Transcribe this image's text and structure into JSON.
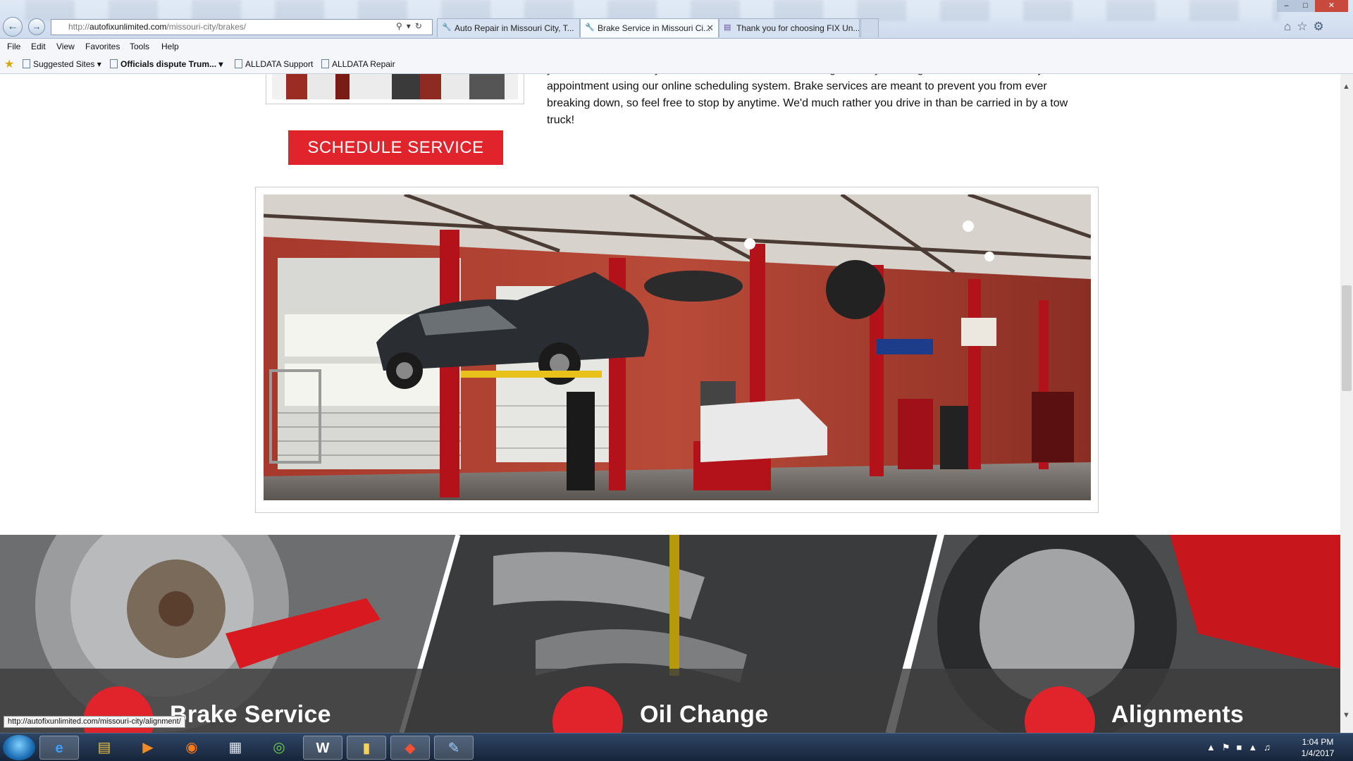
{
  "browser": {
    "url_domain": "autofixunlimited.com",
    "url_prefix": "http://",
    "url_path": "/missouri-city/brakes/",
    "tabs": [
      {
        "label": "Auto Repair in Missouri City, T...",
        "active": false
      },
      {
        "label": "Brake Service in Missouri Ci...",
        "active": true
      },
      {
        "label": "Thank you for choosing FIX Un...",
        "active": false
      }
    ],
    "window_controls": {
      "min": "–",
      "max": "□",
      "close": "✕"
    },
    "menu": [
      "File",
      "Edit",
      "View",
      "Favorites",
      "Tools",
      "Help"
    ],
    "favorites": [
      "Suggested Sites ▾",
      "Officials dispute Trum... ▾",
      "ALLDATA Support",
      "ALLDATA Repair"
    ],
    "status_url": "http://autofixunlimited.com/missouri-city/alignment/"
  },
  "page": {
    "paragraph": "your brake service. If your brakes are need of attention right now, you can go ahead and schedule your appointment using our online scheduling system. Brake services are meant to prevent you from ever breaking down, so feel free to stop by anytime. We'd much rather you drive in than be carried in by a tow truck!",
    "schedule_button": "SCHEDULE SERVICE",
    "services": [
      {
        "label": "Brake Service",
        "icon": "brake-disc-icon"
      },
      {
        "label": "Oil Change",
        "icon": "oil-can-icon"
      },
      {
        "label": "Alignments",
        "icon": "alignment-icon"
      }
    ],
    "accent_color": "#e1232b"
  },
  "taskbar": {
    "time": "1:04 PM",
    "date": "1/4/2017",
    "apps": [
      "internet-explorer",
      "file-explorer",
      "media-player",
      "firefox",
      "calculator",
      "chrome",
      "word",
      "folder",
      "git",
      "paint"
    ]
  }
}
